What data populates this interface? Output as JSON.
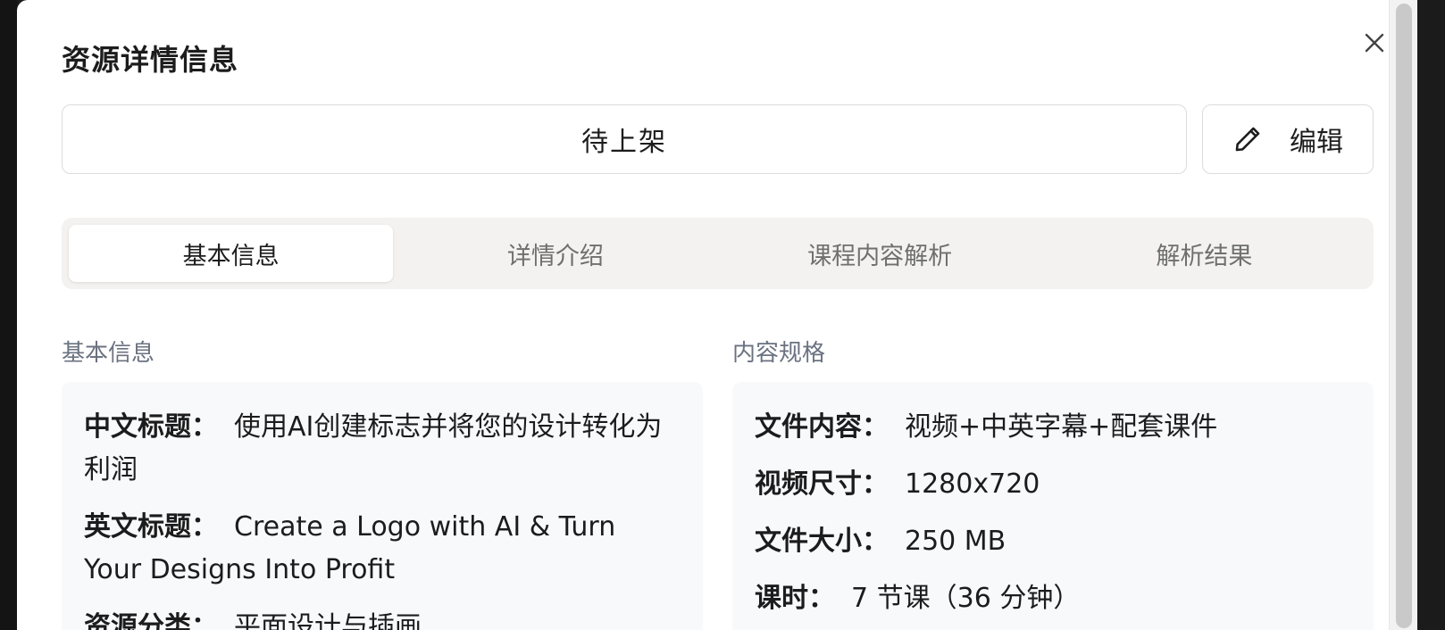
{
  "dialog": {
    "title": "资源详情信息",
    "status": "待上架",
    "edit_label": "编辑"
  },
  "tabs": [
    {
      "label": "基本信息",
      "active": true
    },
    {
      "label": "详情介绍",
      "active": false
    },
    {
      "label": "课程内容解析",
      "active": false
    },
    {
      "label": "解析结果",
      "active": false
    }
  ],
  "basic_info": {
    "section_title": "基本信息",
    "rows": [
      {
        "key": "中文标题：",
        "value": "使用AI创建标志并将您的设计转化为利润"
      },
      {
        "key": "英文标题：",
        "value": "Create a Logo with AI & Turn Your Designs Into Profit"
      },
      {
        "key": "资源分类：",
        "value": "平面设计与插画"
      }
    ]
  },
  "content_spec": {
    "section_title": "内容规格",
    "rows": [
      {
        "key": "文件内容：",
        "value": "视频+中英字幕+配套课件"
      },
      {
        "key": "视频尺寸：",
        "value": "1280x720"
      },
      {
        "key": "文件大小：",
        "value": "250 MB"
      },
      {
        "key": "课时：",
        "value": "7 节课（36 分钟）"
      }
    ]
  },
  "colors": {
    "panel_bg": "#f8f9fb",
    "tabs_bg": "#f3f2f0",
    "muted_text": "#6b7280",
    "border": "#dcdcdc"
  },
  "icons": {
    "close": "close-icon",
    "edit": "pencil-icon"
  }
}
